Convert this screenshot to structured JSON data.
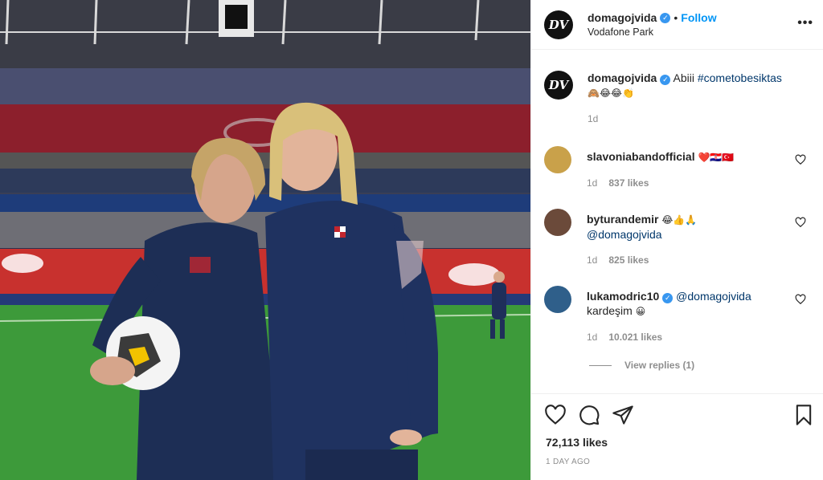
{
  "post": {
    "username": "domagojvida",
    "avatar_initials": "DV",
    "follow_label": "Follow",
    "location": "Vodafone Park",
    "more_icon": "more-horizontal-icon"
  },
  "caption": {
    "username": "domagojvida",
    "text": "Abiii ",
    "hashtag": "#cometobesiktas",
    "emojis": "🙈😂😂👏",
    "time": "1d"
  },
  "comments": [
    {
      "username": "slavoniabandofficial",
      "text": "",
      "emojis": "❤️🇭🇷🇹🇷",
      "time": "1d",
      "likes": "837 likes",
      "avatar_color": "#c9a14a"
    },
    {
      "username": "byturandemir",
      "text": "",
      "emojis": "😂👍🙏",
      "mention": "@domagojvida",
      "time": "1d",
      "likes": "825 likes",
      "avatar_color": "#6b4a3a"
    },
    {
      "username": "lukamodric10",
      "text": "kardeşim ",
      "emojis": "😀",
      "mention": "@domagojvida",
      "time": "1d",
      "likes": "10.021 likes",
      "avatar_color": "#2f5f8a"
    }
  ],
  "view_replies": "View replies (1)",
  "actions": {
    "likes": "72,113 likes",
    "date": "1 DAY AGO"
  },
  "colors": {
    "link": "#00376b",
    "accent": "#0095f6",
    "verified": "#3897f0",
    "muted": "#8e8e8e"
  }
}
